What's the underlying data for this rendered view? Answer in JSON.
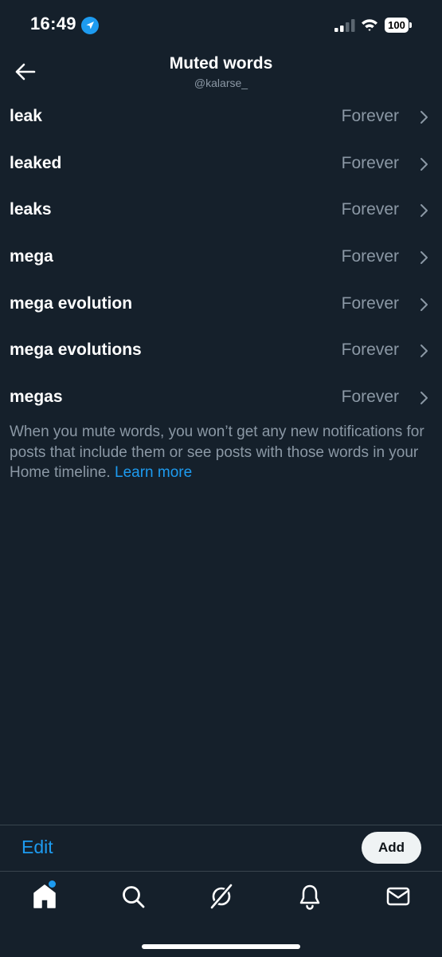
{
  "status_bar": {
    "time": "16:49",
    "battery": "100",
    "icons": [
      "location-arrow-icon",
      "signal-icon",
      "wifi-icon",
      "battery-icon"
    ]
  },
  "header": {
    "title": "Muted words",
    "subtitle": "@kalarse_",
    "back_icon": "back-arrow-icon"
  },
  "muted_words": [
    {
      "word": "leak",
      "duration": "Forever"
    },
    {
      "word": "leaked",
      "duration": "Forever"
    },
    {
      "word": "leaks",
      "duration": "Forever"
    },
    {
      "word": "mega",
      "duration": "Forever"
    },
    {
      "word": "mega evolution",
      "duration": "Forever"
    },
    {
      "word": "mega evolutions",
      "duration": "Forever"
    },
    {
      "word": "megas",
      "duration": "Forever"
    }
  ],
  "info": {
    "text": "When you mute words, you won’t get any new notifications for posts that include them or see posts with those words in your Home timeline. ",
    "link": "Learn more"
  },
  "actions": {
    "edit": "Edit",
    "add": "Add"
  },
  "tab_bar": {
    "tabs": [
      "home-icon",
      "search-icon",
      "grok-icon",
      "notifications-bell-icon",
      "messages-envelope-icon"
    ],
    "home_has_notification_dot": true
  },
  "colors": {
    "background": "#15202b",
    "accent": "#1d9bf0",
    "secondary_text": "#8b98a5",
    "divider": "#38444d"
  }
}
